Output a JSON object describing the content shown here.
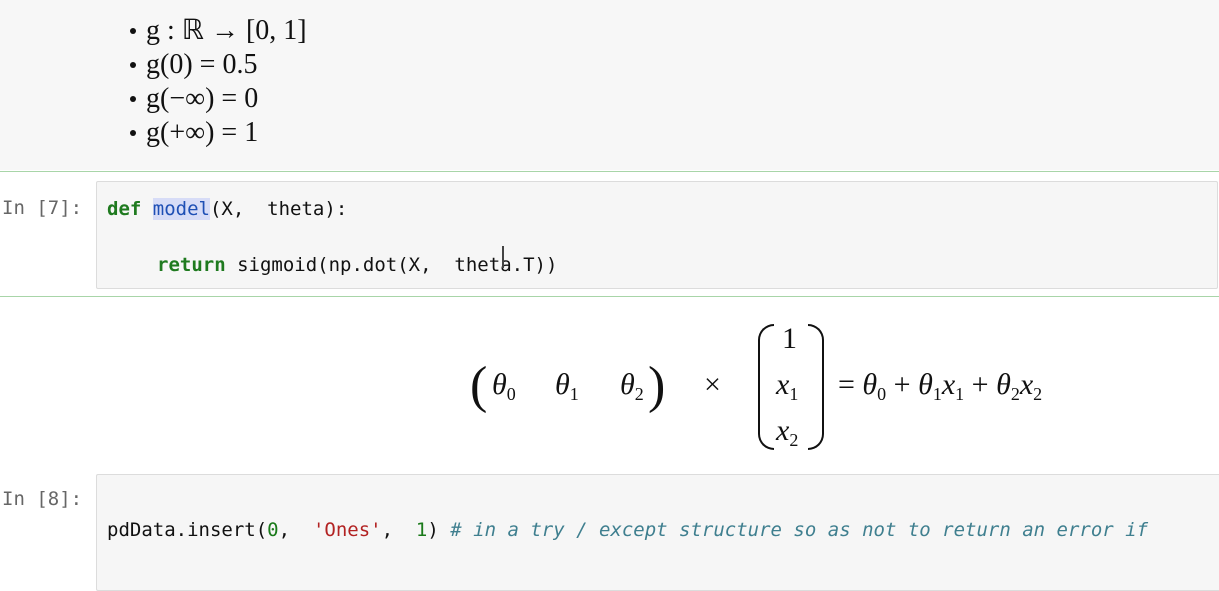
{
  "bullets": [
    "g : ℝ → [0, 1]",
    "g(0) = 0.5",
    "g(−∞) = 0",
    "g(+∞) = 1"
  ],
  "cell7": {
    "prompt": "In [7]:",
    "def_kw": "def",
    "fn_name": "model",
    "signature": "(X,  theta):",
    "return_kw": "return",
    "return_expr": "sigmoid(np.dot(X,  theta.T))"
  },
  "math": {
    "row_vector": [
      "θ0",
      "θ1",
      "θ2"
    ],
    "times": "×",
    "col_vector": [
      "1",
      "x1",
      "x2"
    ],
    "rhs": "= θ0 + θ1x1 + θ2x2"
  },
  "cell8": {
    "prompt": "In [8]:",
    "call": "pdData.insert(",
    "arg1": "0",
    "sep1": ",  ",
    "arg2": "'Ones'",
    "sep2": ",  ",
    "arg3": "1",
    "close": ")",
    "comment": "# in a try / except structure so as not to return an error if"
  }
}
